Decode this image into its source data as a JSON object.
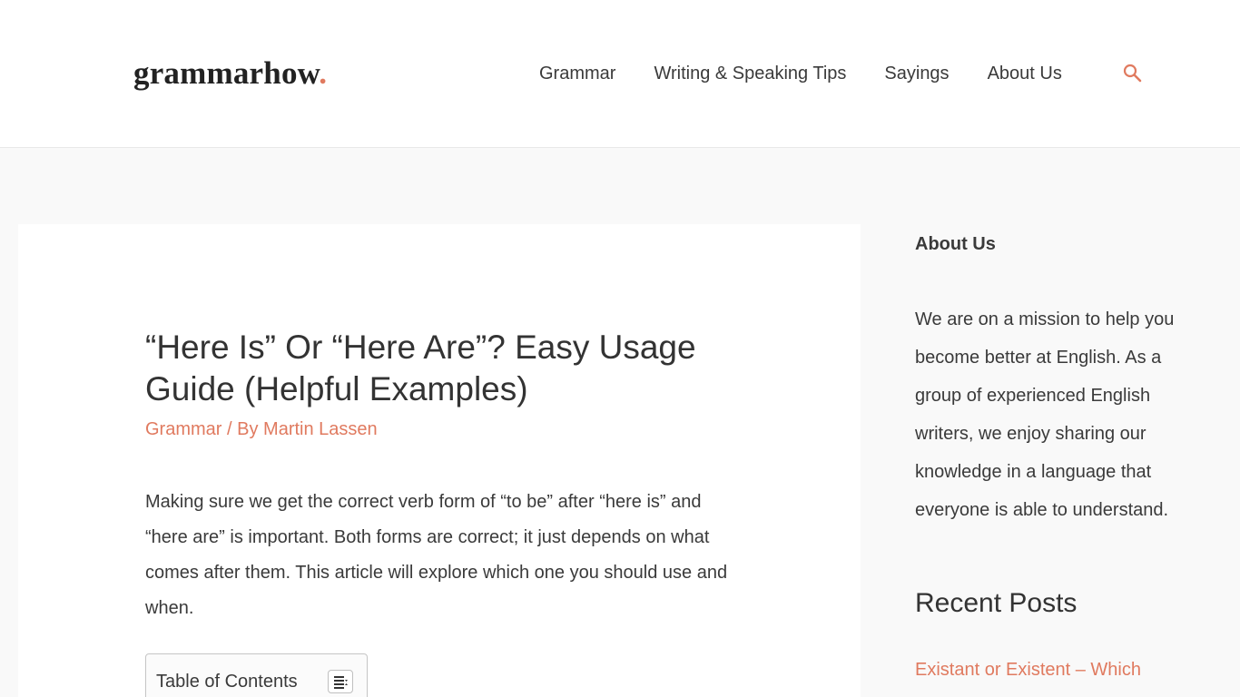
{
  "header": {
    "logo_text": "grammarhow",
    "logo_dot": ".",
    "nav": [
      {
        "label": "Grammar"
      },
      {
        "label": "Writing & Speaking Tips"
      },
      {
        "label": "Sayings"
      },
      {
        "label": "About Us"
      }
    ],
    "search_icon": "search-icon"
  },
  "article": {
    "title": "“Here Is” Or “Here Are”? Easy Usage Guide (Helpful Examples)",
    "category": "Grammar",
    "separator": " / By ",
    "author": "Martin Lassen",
    "intro": "Making sure we get the correct verb form of “to be” after “here is” and “here are” is important. Both forms are correct; it just depends on what comes after them. This article will explore which one you should use and when.",
    "toc_title": "Table of Contents",
    "toc_icon": "list-toggle-icon"
  },
  "sidebar": {
    "about_title": "About Us",
    "about_text": "We are on a mission to help you become better at English. As a group of experienced English writers, we enjoy sharing our knowledge in a language that everyone is able to understand.",
    "recent_title": "Recent Posts",
    "recent_posts": [
      {
        "label": "Existant or Existent – Which"
      }
    ]
  },
  "colors": {
    "accent": "#e07a5f",
    "text": "#3a3a3a",
    "background": "#f9f9f9"
  }
}
